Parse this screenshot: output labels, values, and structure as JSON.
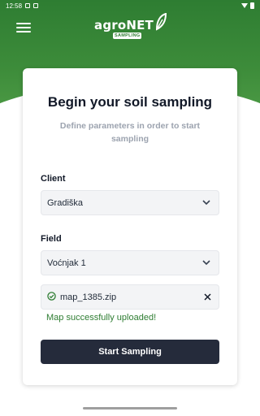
{
  "status_bar": {
    "time": "12:58"
  },
  "header": {
    "logo_text": "agroNET",
    "logo_badge": "SAMPLING"
  },
  "card": {
    "title": "Begin your soil sampling",
    "subtitle": "Define parameters in order to start sampling"
  },
  "client": {
    "label": "Client",
    "value": "Gradiška"
  },
  "field": {
    "label": "Field",
    "value": "Voćnjak 1"
  },
  "upload": {
    "file_name": "map_1385.zip",
    "message": "Map successfully uploaded!"
  },
  "actions": {
    "start_label": "Start Sampling"
  },
  "colors": {
    "brand_green": "#2e7d32",
    "button_dark": "#252b3b",
    "success_green": "#2e7d32"
  },
  "icons": [
    "menu-icon",
    "logo-leaf-icon",
    "chevron-down-icon",
    "check-circle-icon",
    "close-icon"
  ]
}
